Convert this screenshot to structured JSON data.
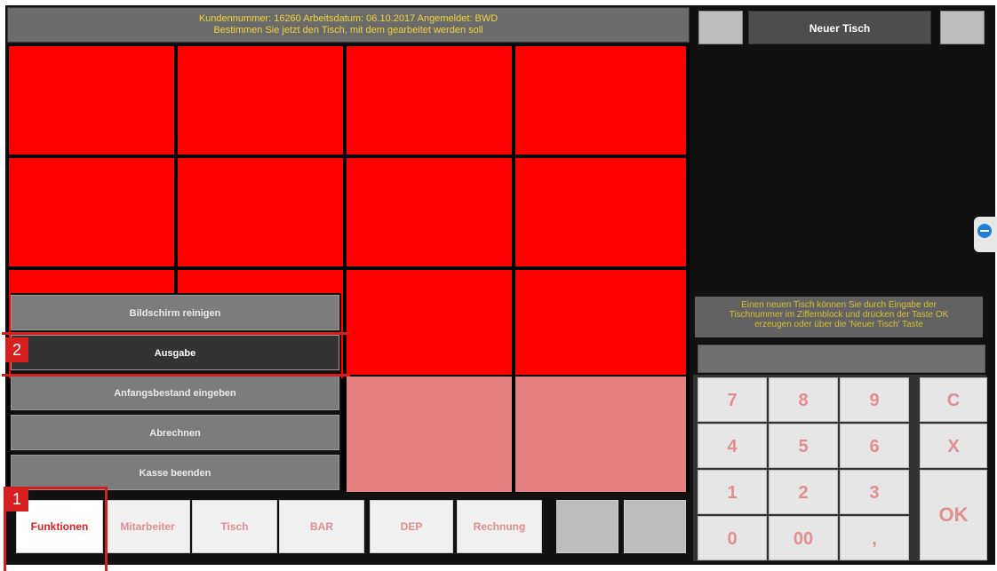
{
  "header": {
    "line1": "Kundennummer: 16260 Arbeitsdatum: 06.10.2017 Angemeldet: BWD",
    "line2": "Bestimmen Sie jetzt den Tisch, mit dem gearbeitet werden soll"
  },
  "right_panel": {
    "new_table_label": "Neuer Tisch",
    "info_line1": "Einen neuen Tisch können Sie durch Eingabe der",
    "info_line2": "Tischnummer im Ziffernblock und drücken der Taste OK",
    "info_line3": "erzeugen oder über die 'Neuer Tisch' Taste"
  },
  "menu": {
    "items": [
      {
        "label": "Bildschirm reinigen"
      },
      {
        "label": "Ausgabe"
      },
      {
        "label": "Anfangsbestand eingeben"
      },
      {
        "label": "Abrechnen"
      },
      {
        "label": "Kasse beenden"
      }
    ]
  },
  "tabs": [
    {
      "label": "Funktionen"
    },
    {
      "label": "Mitarbeiter"
    },
    {
      "label": "Tisch"
    },
    {
      "label": "BAR"
    },
    {
      "label": "DEP"
    },
    {
      "label": "Rechnung"
    },
    {
      "label": ""
    },
    {
      "label": ""
    }
  ],
  "keypad": {
    "keys": [
      "7",
      "8",
      "9",
      "4",
      "5",
      "6",
      "1",
      "2",
      "3",
      "0",
      "00",
      ","
    ],
    "clear": "C",
    "cancel": "X",
    "ok": "OK"
  },
  "callouts": {
    "one": "1",
    "two": "2"
  },
  "colors": {
    "table_red": "#ff0000",
    "header_yellow": "#f0d23a",
    "active_tab_red": "#e02020"
  }
}
